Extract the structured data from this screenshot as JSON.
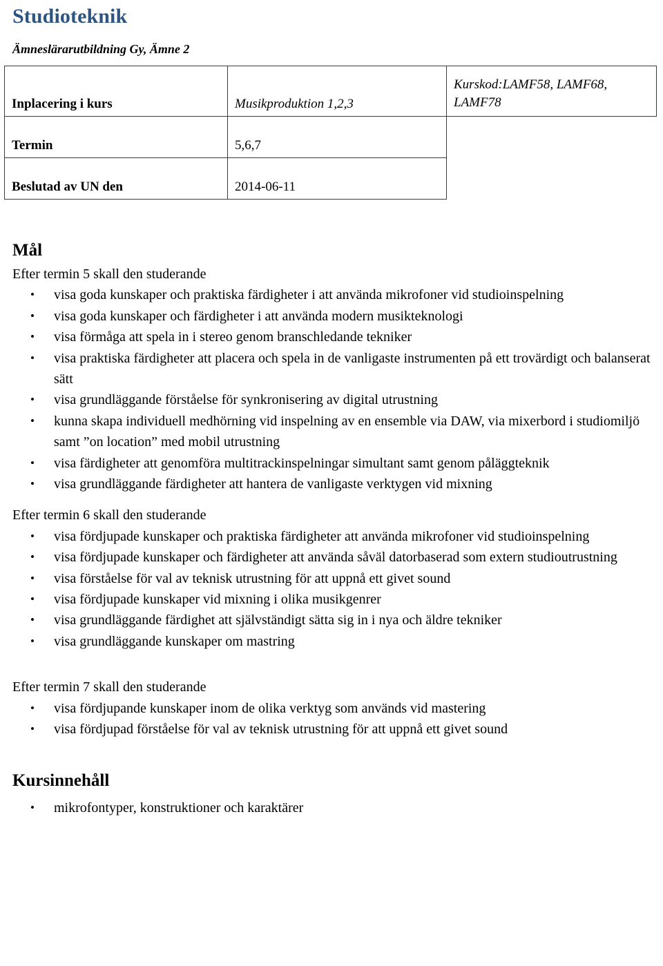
{
  "document": {
    "title": "Studioteknik",
    "subtitle": "Ämneslärarutbildning Gy, Ämne 2",
    "title_color": "#2e5580"
  },
  "info_table": {
    "rows": [
      {
        "label": "Inplacering i kurs",
        "value": "Musikproduktion 1,2,3",
        "extra": "Kurskod:LAMF58, LAMF68, LAMF78"
      },
      {
        "label": "Termin",
        "value": "5,6,7",
        "extra": ""
      },
      {
        "label": "Beslutad av UN den",
        "value": "2014-06-11",
        "extra": ""
      }
    ]
  },
  "goals": {
    "heading": "Mål",
    "groups": [
      {
        "lead": "Efter termin 5 skall den studerande",
        "items": [
          "visa goda kunskaper och praktiska färdigheter i att använda mikrofoner vid studioinspelning",
          "visa goda kunskaper och färdigheter i att använda modern musikteknologi",
          "visa förmåga att spela in i stereo genom branschledande tekniker",
          "visa praktiska färdigheter att placera och spela in de vanligaste instrumenten på ett trovärdigt och balanserat sätt",
          "visa grundläggande förståelse för synkronisering av digital utrustning",
          "kunna skapa individuell medhörning vid inspelning av en ensemble via DAW, via mixerbord i studiomiljö samt ”on location” med mobil utrustning",
          " visa färdigheter att genomföra multitrackinspelningar simultant samt genom påläggteknik",
          "visa grundläggande färdigheter att hantera de vanligaste verktygen vid mixning"
        ]
      },
      {
        "lead": "Efter termin 6 skall den studerande",
        "items": [
          "visa fördjupade kunskaper och praktiska färdigheter att använda mikrofoner vid studioinspelning",
          "visa fördjupade kunskaper och färdigheter att använda såväl datorbaserad som extern studioutrustning",
          "visa förståelse för val av teknisk utrustning för att uppnå ett givet sound",
          "visa fördjupade kunskaper vid mixning i olika musikgenrer",
          "visa grundläggande färdighet att självständigt sätta sig in i nya och äldre tekniker",
          "visa grundläggande kunskaper om mastring"
        ]
      },
      {
        "lead": "Efter termin 7 skall den studerande",
        "items": [
          "visa fördjupande kunskaper inom de olika verktyg som används vid mastering",
          "visa fördjupad förståelse för val av teknisk utrustning för att uppnå ett givet sound"
        ]
      }
    ]
  },
  "course_content": {
    "heading": "Kursinnehåll",
    "items": [
      "mikrofontyper, konstruktioner och karaktärer"
    ]
  }
}
